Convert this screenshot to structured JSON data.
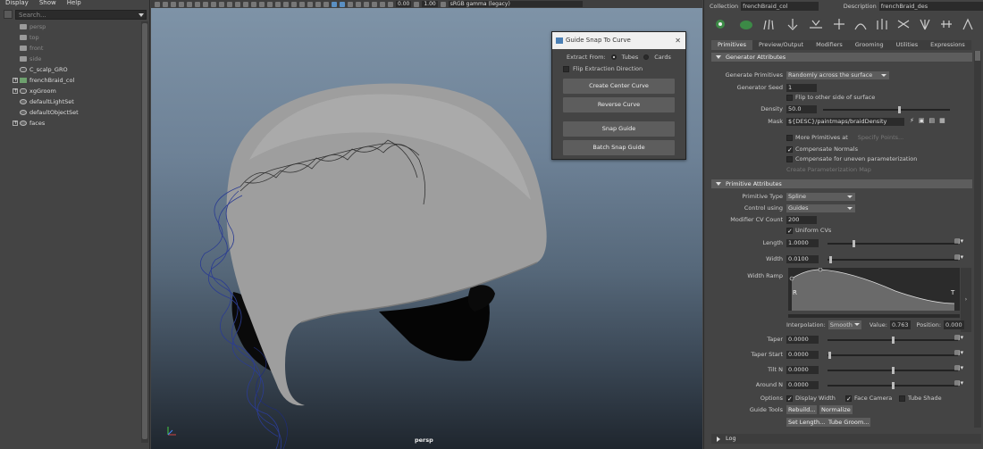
{
  "outliner": {
    "menu": [
      "Display",
      "Show",
      "Help"
    ],
    "search_placeholder": "Search...",
    "items": [
      {
        "label": "persp",
        "type": "camera",
        "dim": true,
        "expand": false
      },
      {
        "label": "top",
        "type": "camera",
        "dim": true,
        "expand": false
      },
      {
        "label": "front",
        "type": "camera",
        "dim": true,
        "expand": false
      },
      {
        "label": "side",
        "type": "camera",
        "dim": true,
        "expand": false
      },
      {
        "label": "C_scalp_GRO",
        "type": "transform",
        "dim": false,
        "expand": false
      },
      {
        "label": "frenchBraid_col",
        "type": "collection",
        "dim": false,
        "expand": true
      },
      {
        "label": "xgGroom",
        "type": "transform",
        "dim": false,
        "expand": true
      },
      {
        "label": "defaultLightSet",
        "type": "set",
        "dim": false,
        "expand": false
      },
      {
        "label": "defaultObjectSet",
        "type": "set",
        "dim": false,
        "expand": false
      },
      {
        "label": "faces",
        "type": "group",
        "dim": false,
        "expand": true
      }
    ]
  },
  "viewport": {
    "toolbar": {
      "value1": "0.00",
      "value2": "1.00",
      "color_space": "sRGB gamma (legacy)"
    },
    "camera_label": "persp"
  },
  "snap_dialog": {
    "title": "Guide Snap To Curve",
    "extract_from_label": "Extract From:",
    "option_tubes": "Tubes",
    "option_cards": "Cards",
    "flip_label": "Flip Extraction Direction",
    "buttons": {
      "create_center": "Create Center Curve",
      "reverse": "Reverse Curve",
      "snap": "Snap Guide",
      "batch_snap": "Batch Snap Guide"
    }
  },
  "attr": {
    "collection_label": "Collection",
    "collection_value": "frenchBraid_col",
    "description_label": "Description",
    "description_value": "frenchBraid_des",
    "tabs": [
      "Primitives",
      "Preview/Output",
      "Modifiers",
      "Grooming",
      "Utilities",
      "Expressions"
    ],
    "generator": {
      "header": "Generator Attributes",
      "generate_label": "Generate Primitives",
      "generate_value": "Randomly across the surface",
      "seed_label": "Generator Seed",
      "seed_value": "1",
      "flip_label": "Flip to other side of surface",
      "density_label": "Density",
      "density_value": "50.0",
      "mask_label": "Mask",
      "mask_value": "${DESC}/paintmaps/braidDensity",
      "more_prims_label": "More Primitives at",
      "specify_points": "Specify Points...",
      "compensate_normals": "Compensate Normals",
      "compensate_uneven": "Compensate for uneven parameterization",
      "create_param_map": "Create Parameterization Map"
    },
    "primitive": {
      "header": "Primitive Attributes",
      "type_label": "Primitive Type",
      "type_value": "Spline",
      "control_label": "Control using",
      "control_value": "Guides",
      "cv_label": "Modifier CV Count",
      "cv_value": "200",
      "uniform_cvs": "Uniform CVs",
      "length_label": "Length",
      "length_value": "1.0000",
      "width_label": "Width",
      "width_value": "0.0100",
      "ramp_label": "Width Ramp",
      "ramp_left": "R",
      "ramp_right": "T",
      "interp_label": "Interpolation:",
      "interp_value": "Smooth",
      "value_label": "Value:",
      "value_value": "0.763",
      "position_label": "Position:",
      "position_value": "0.000",
      "taper_label": "Taper",
      "taper_value": "0.0000",
      "taper_start_label": "Taper Start",
      "taper_start_value": "0.0000",
      "tilt_label": "Tilt N",
      "tilt_value": "0.0000",
      "around_label": "Around N",
      "around_value": "0.0000",
      "options_label": "Options",
      "display_width": "Display Width",
      "face_camera": "Face Camera",
      "tube_shade": "Tube Shade",
      "guide_tools_label": "Guide Tools",
      "rebuild": "Rebuild...",
      "normalize": "Normalize",
      "set_length": "Set Length...",
      "tube_groom": "Tube Groom..."
    },
    "log": "Log"
  }
}
